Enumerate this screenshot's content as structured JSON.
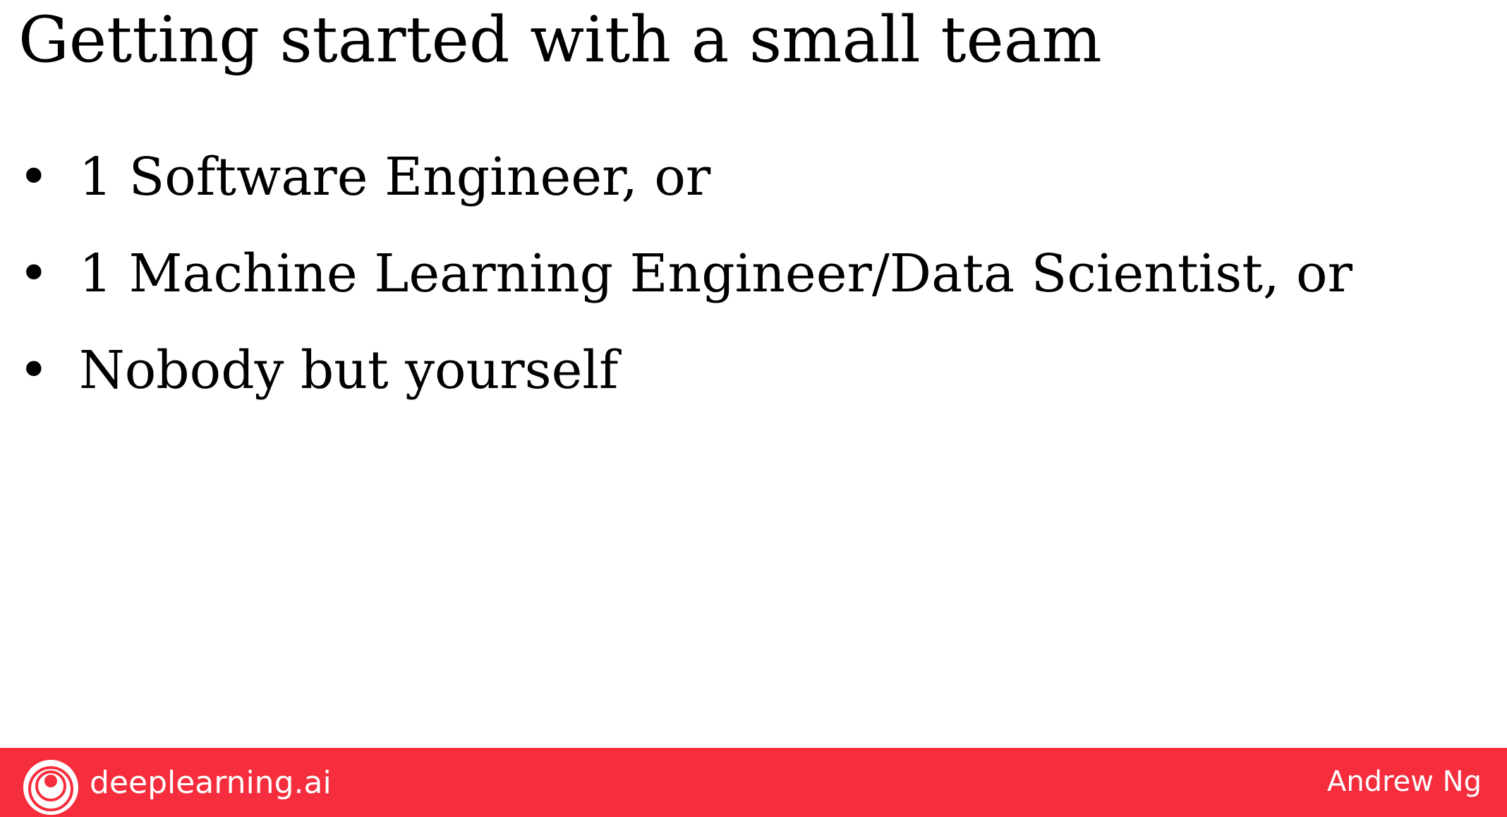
{
  "slide": {
    "title": "Getting started with a small team",
    "bullets": [
      {
        "marker": "•",
        "text": "1 Software Engineer, or"
      },
      {
        "marker": "•",
        "text": "1 Machine Learning Engineer/Data Scientist, or"
      },
      {
        "marker": "•",
        "text": "Nobody but yourself"
      }
    ]
  },
  "footer": {
    "brand": "deeplearning.ai",
    "brand_icon": "deeplearning-logo-icon",
    "author": "Andrew Ng",
    "bar_color": "#f52d3c"
  }
}
